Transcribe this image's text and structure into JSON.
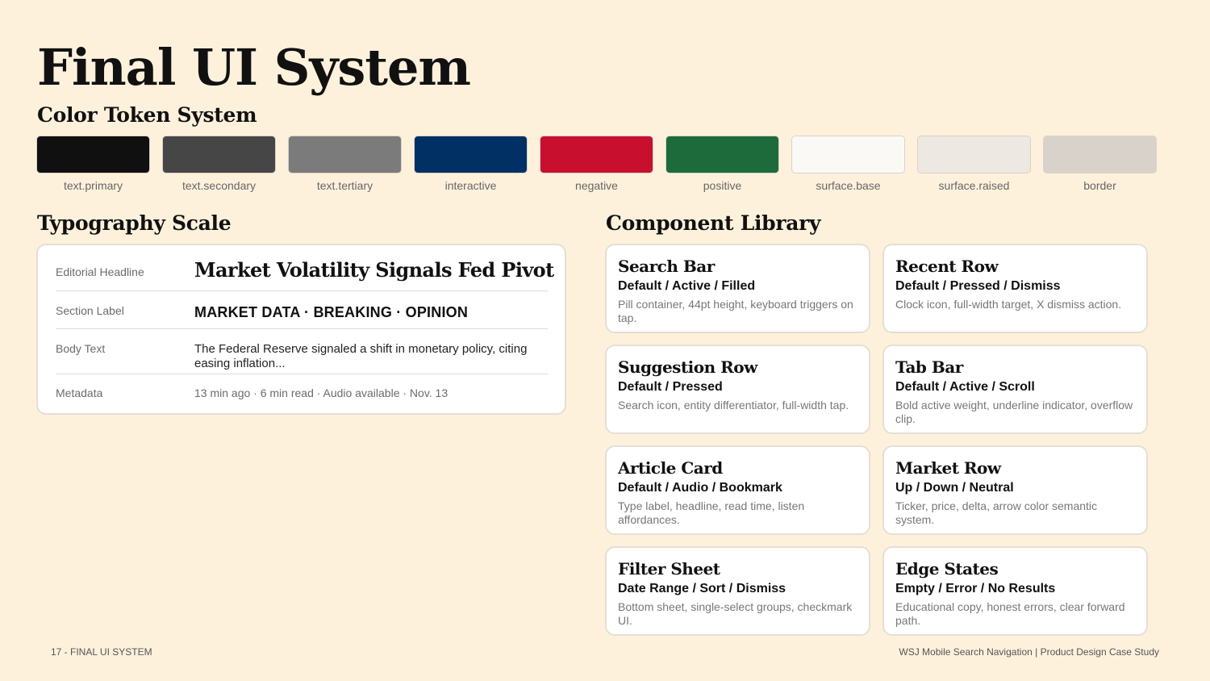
{
  "title": "Final UI System",
  "colors": {
    "heading": "Color Token System",
    "tokens": [
      {
        "name": "text.primary",
        "hex": "#101010"
      },
      {
        "name": "text.secondary",
        "hex": "#464646"
      },
      {
        "name": "text.tertiary",
        "hex": "#7b7b7b"
      },
      {
        "name": "interactive",
        "hex": "#003064"
      },
      {
        "name": "negative",
        "hex": "#C8102E"
      },
      {
        "name": "positive",
        "hex": "#1D6B3A"
      },
      {
        "name": "surface.base",
        "hex": "#FAF9F6"
      },
      {
        "name": "surface.raised",
        "hex": "#EDE8E1"
      },
      {
        "name": "border",
        "hex": "#D9D2CA"
      }
    ]
  },
  "typography": {
    "heading": "Typography Scale",
    "rows": [
      {
        "label": "Editorial Headline",
        "sample": "Market Volatility Signals Fed Pivot"
      },
      {
        "label": "Section Label",
        "sample": "MARKET DATA · BREAKING · OPINION"
      },
      {
        "label": "Body Text",
        "sample": "The Federal Reserve signaled a shift in monetary policy, citing easing inflation..."
      },
      {
        "label": "Metadata",
        "sample": "13 min ago · 6 min read · Audio available · Nov. 13"
      }
    ]
  },
  "components": {
    "heading": "Component Library",
    "items": [
      {
        "title": "Search Bar",
        "states": "Default / Active / Filled",
        "desc": "Pill container, 44pt height, keyboard triggers on tap."
      },
      {
        "title": "Recent Row",
        "states": "Default / Pressed / Dismiss",
        "desc": "Clock icon, full-width target, X dismiss action."
      },
      {
        "title": "Suggestion Row",
        "states": "Default / Pressed",
        "desc": "Search icon, entity differentiator, full-width tap."
      },
      {
        "title": "Tab Bar",
        "states": "Default / Active / Scroll",
        "desc": "Bold active weight, underline indicator, overflow clip."
      },
      {
        "title": "Article Card",
        "states": "Default / Audio / Bookmark",
        "desc": "Type label, headline, read time, listen affordances."
      },
      {
        "title": "Market Row",
        "states": "Up / Down / Neutral",
        "desc": "Ticker, price, delta, arrow color semantic system."
      },
      {
        "title": "Filter Sheet",
        "states": "Date Range / Sort / Dismiss",
        "desc": "Bottom sheet, single-select groups, checkmark UI."
      },
      {
        "title": "Edge States",
        "states": "Empty / Error / No Results",
        "desc": "Educational copy, honest errors, clear forward path."
      }
    ]
  },
  "footer": {
    "left": "17 - FINAL UI SYSTEM",
    "right": "WSJ Mobile Search Navigation | Product Design Case Study"
  }
}
